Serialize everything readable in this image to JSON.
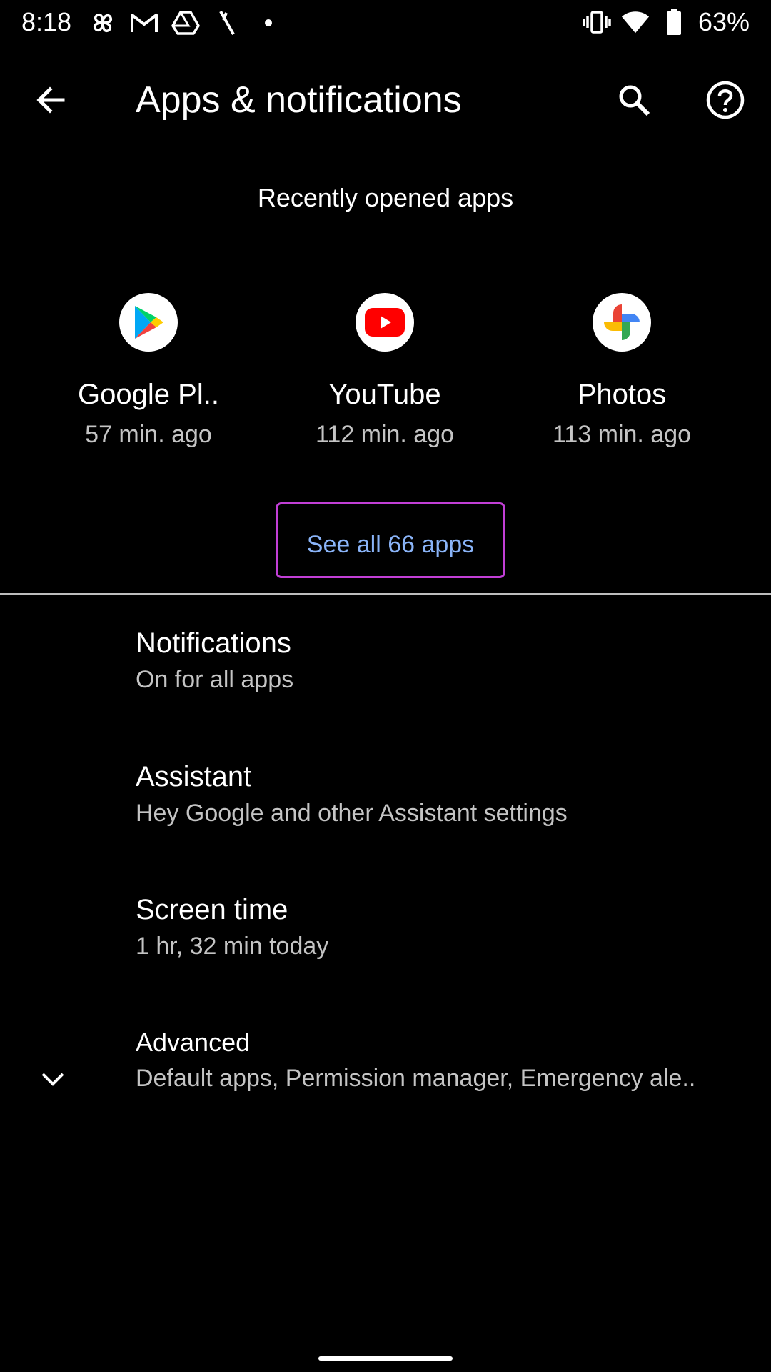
{
  "status_bar": {
    "time": "8:18",
    "left_icons": [
      "pinwheel-icon",
      "gmail-icon",
      "drive-icon",
      "signal-off-icon",
      "dot-icon"
    ],
    "right_icons": [
      "vibrate-icon",
      "wifi-icon",
      "battery-icon"
    ],
    "battery": "63%"
  },
  "header": {
    "title": "Apps & notifications",
    "back_icon": "arrow-left-icon",
    "search_icon": "search-icon",
    "help_icon": "help-icon"
  },
  "recent": {
    "title": "Recently opened apps",
    "apps": [
      {
        "name": "Google Pl..",
        "time": "57 min. ago",
        "icon": "google-play-icon"
      },
      {
        "name": "YouTube",
        "time": "112 min. ago",
        "icon": "youtube-icon"
      },
      {
        "name": "Photos",
        "time": "113 min. ago",
        "icon": "photos-icon"
      }
    ],
    "see_all_label": "See all 66 apps"
  },
  "settings": {
    "items": [
      {
        "title": "Notifications",
        "subtitle": "On for all apps"
      },
      {
        "title": "Assistant",
        "subtitle": "Hey Google and other Assistant settings"
      },
      {
        "title": "Screen time",
        "subtitle": "1 hr, 32 min today"
      },
      {
        "title": "Advanced",
        "subtitle": "Default apps, Permission manager, Emergency ale..",
        "icon": "chevron-down-icon"
      }
    ]
  },
  "colors": {
    "background": "#000000",
    "accent_link": "#8ab4f8",
    "highlight_border": "#c13fd6",
    "secondary_text": "#c4c4c4"
  }
}
